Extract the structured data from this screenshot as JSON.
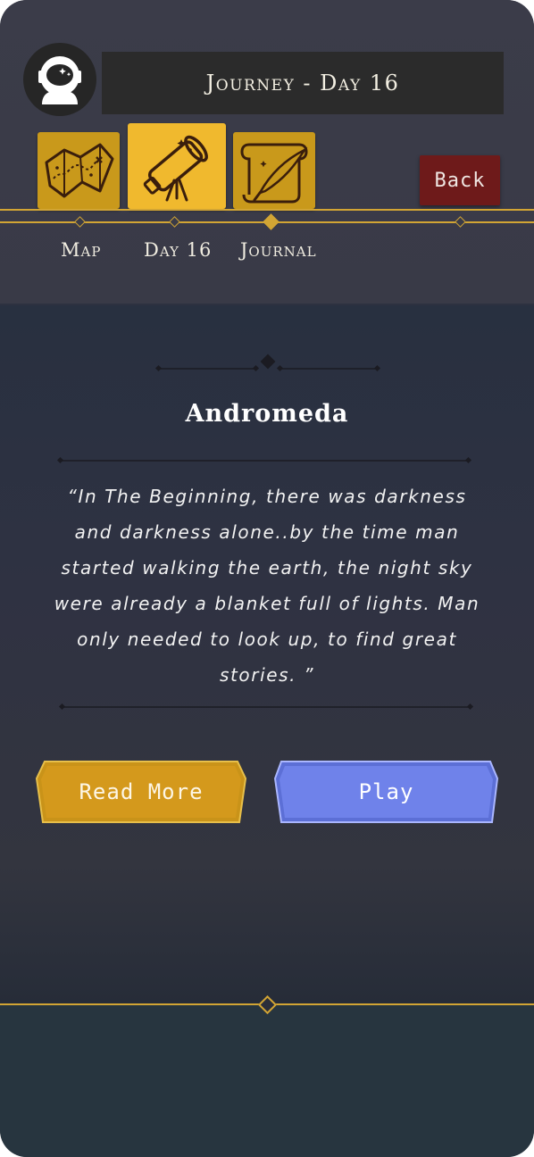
{
  "header": {
    "title": "Journey - Day 16",
    "avatar_icon": "astronaut-helmet-icon",
    "back_label": "Back"
  },
  "tabs": [
    {
      "label": "Map",
      "icon": "treasure-map-icon",
      "active": false
    },
    {
      "label": "Day 16",
      "icon": "telescope-icon",
      "active": true
    },
    {
      "label": "Journal",
      "icon": "quill-scroll-icon",
      "active": false
    }
  ],
  "story": {
    "title": "Andromeda",
    "quote": "“In The Beginning, there was darkness and darkness alone..by the time man started walking the earth, the night sky were already a blanket full of lights. Man only needed to look up, to find great stories. ”"
  },
  "actions": {
    "read_more_label": "Read More",
    "play_label": "Play"
  },
  "colors": {
    "gold": "#d2a534",
    "tab_gold": "#c9991b",
    "active_tab": "#f0b92e",
    "back_red": "#6e1a1a",
    "play_blue": "#6f82ea",
    "read_orange": "#d4991c",
    "background": "#3a3b48",
    "footer": "#27353f"
  }
}
